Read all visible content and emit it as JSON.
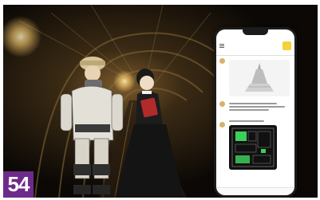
{
  "badge": {
    "number": "54"
  },
  "colors": {
    "badge": "#6e2a8a",
    "app_accent": "#f3d23a",
    "floorplan_room": "#3ccf5a",
    "tunnel_light": "#f2c46a"
  },
  "phone": {
    "status_time": "",
    "app_title": "",
    "app_subtitle": "",
    "icons": [
      "menu-icon",
      "map-icon",
      "sculpture-illustration",
      "floor-plan"
    ]
  }
}
